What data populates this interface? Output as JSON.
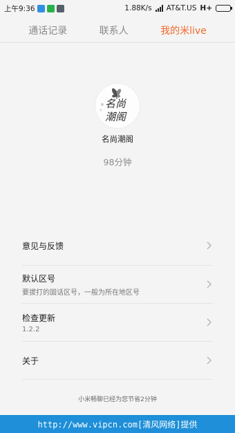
{
  "status_bar": {
    "time": "上午9:36",
    "icons": [
      "app-notification-icon",
      "wechat-icon",
      "photo-icon"
    ],
    "net_speed": "1.88K/s",
    "carrier": "AT&T.US",
    "network_type": "H+",
    "battery_level": 0.9
  },
  "tabs": [
    {
      "label": "通话记录"
    },
    {
      "label": "联系人"
    },
    {
      "label": "我的米live"
    }
  ],
  "active_tab": 2,
  "profile": {
    "avatar_text": "名尚\n潮阁",
    "name": "名尚潮阁",
    "minutes": "98分钟"
  },
  "menu": {
    "items": [
      {
        "title": "意见与反馈",
        "subtitle": ""
      },
      {
        "title": "默认区号",
        "subtitle": "要拔打的固话区号，一般为所在地区号"
      },
      {
        "title": "检查更新",
        "subtitle": "1.2.2"
      },
      {
        "title": "关于",
        "subtitle": ""
      }
    ]
  },
  "footer_note": "小米畅聊已经为您节省2分钟",
  "watermark": "http://www.vipcn.com[清风网络]提供",
  "colors": {
    "accent": "#f36a2b",
    "background": "#f4f4f4",
    "watermark_bg": "#1e8fd8"
  }
}
